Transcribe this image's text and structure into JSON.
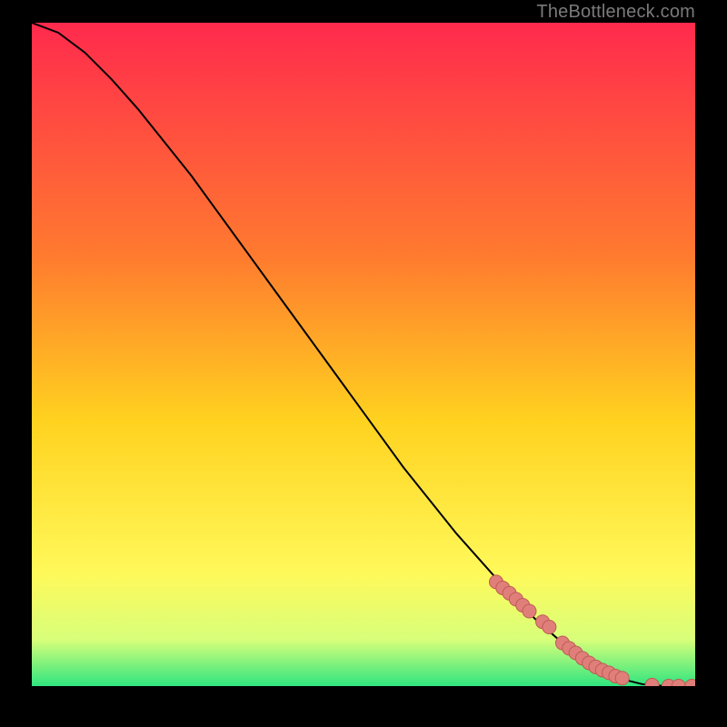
{
  "attribution": "TheBottleneck.com",
  "colors": {
    "gradient_top": "#ff2a4d",
    "gradient_mid1": "#ff7a2f",
    "gradient_mid2": "#ffd21f",
    "gradient_mid3": "#fff95a",
    "gradient_mid4": "#d8ff7a",
    "gradient_bottom": "#2fe57f",
    "curve": "#000000",
    "marker_fill": "#e07f7a",
    "marker_stroke": "#bd5b55"
  },
  "chart_data": {
    "type": "line",
    "title": "",
    "xlabel": "",
    "ylabel": "",
    "xlim": [
      0,
      100
    ],
    "ylim": [
      0,
      100
    ],
    "series": [
      {
        "name": "curve",
        "x": [
          0,
          4,
          8,
          12,
          16,
          20,
          24,
          28,
          32,
          36,
          40,
          44,
          48,
          52,
          56,
          60,
          64,
          68,
          72,
          76,
          80,
          84,
          88,
          90,
          92,
          94,
          95,
          96,
          100
        ],
        "y": [
          100,
          98.5,
          95.5,
          91.5,
          87,
          82,
          77,
          71.5,
          66,
          60.5,
          55,
          49.5,
          44,
          38.5,
          33,
          28,
          23,
          18.5,
          14,
          10,
          6.5,
          3.5,
          1.5,
          0.8,
          0.3,
          0.1,
          0.05,
          0,
          0
        ]
      }
    ],
    "markers": {
      "name": "points-on-curve",
      "x": [
        70,
        71,
        72,
        73,
        74,
        75,
        77,
        78,
        80,
        81,
        82,
        83,
        84,
        85,
        86,
        87,
        88,
        89,
        93.5,
        96,
        97.5,
        99.5
      ],
      "y": [
        15.7,
        14.8,
        14.0,
        13.1,
        12.2,
        11.3,
        9.7,
        8.9,
        6.5,
        5.7,
        5.0,
        4.2,
        3.5,
        2.9,
        2.4,
        2.0,
        1.5,
        1.2,
        0.15,
        0,
        0,
        0
      ]
    }
  }
}
